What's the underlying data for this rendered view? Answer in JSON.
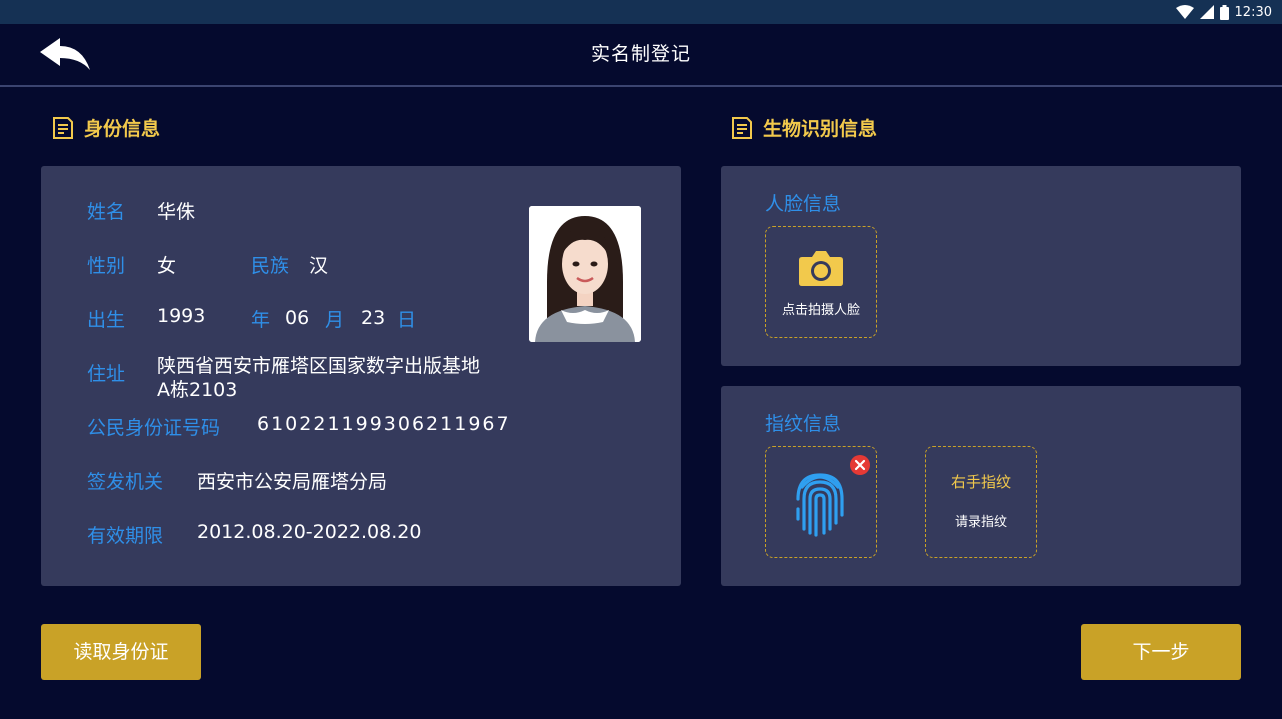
{
  "status_bar": {
    "time": "12:30"
  },
  "header": {
    "title": "实名制登记"
  },
  "identity": {
    "section_title": "身份信息",
    "name_label": "姓名",
    "name_value": "华侏",
    "gender_label": "性别",
    "gender_value": "女",
    "ethnicity_label": "民族",
    "ethnicity_value": "汉",
    "birth_label": "出生",
    "birth_year": "1993",
    "year_unit": "年",
    "birth_month": "06",
    "month_unit": "月",
    "birth_day": "23",
    "day_unit": "日",
    "address_label": "住址",
    "address_line1": "陕西省西安市雁塔区国家数字出版基地",
    "address_line2": "A栋2103",
    "id_label": "公民身份证号码",
    "id_value": "610221199306211967",
    "issuer_label": "签发机关",
    "issuer_value": "西安市公安局雁塔分局",
    "validity_label": "有效期限",
    "validity_value": "2012.08.20-2022.08.20"
  },
  "biometric": {
    "section_title": "生物识别信息",
    "face_title": "人脸信息",
    "face_button_label": "点击拍摄人脸",
    "fingerprint_title": "指纹信息",
    "right_hand_title": "右手指纹",
    "right_hand_prompt": "请录指纹"
  },
  "actions": {
    "read_id_label": "读取身份证",
    "next_label": "下一步"
  },
  "colors": {
    "background": "#050a2e",
    "panel": "#353a5c",
    "label_blue": "#2f8fe8",
    "accent_gold": "#c9a227",
    "section_yellow": "#f2c94c",
    "remove_red": "#e53935"
  }
}
